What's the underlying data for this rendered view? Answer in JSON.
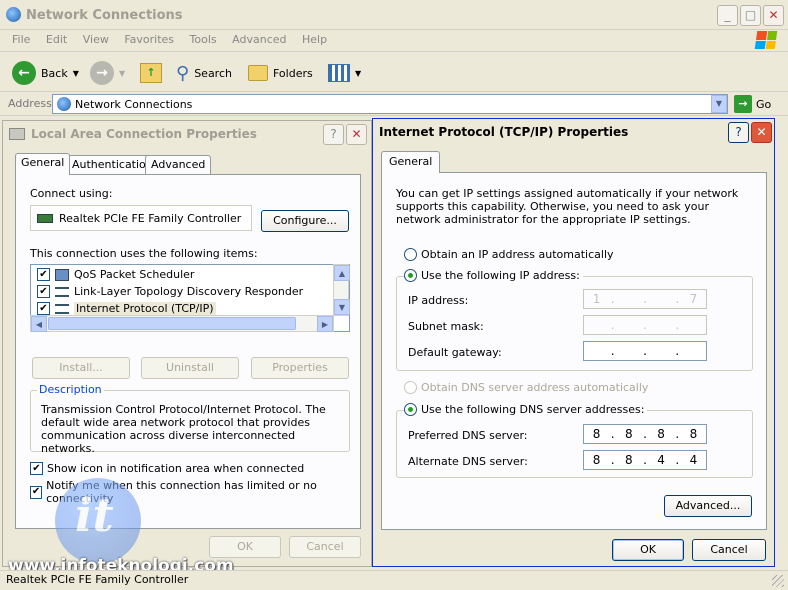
{
  "explorer": {
    "title": "Network Connections",
    "menu": [
      "File",
      "Edit",
      "View",
      "Favorites",
      "Tools",
      "Advanced",
      "Help"
    ],
    "toolbar": {
      "back": "Back",
      "search": "Search",
      "folders": "Folders"
    },
    "address_label": "Address",
    "address_value": "Network Connections",
    "go_label": "Go",
    "status_text": "Realtek PCIe FE Family Controller"
  },
  "lac_dialog": {
    "title": "Local Area Connection Properties",
    "tabs": [
      "General",
      "Authentication",
      "Advanced"
    ],
    "connect_using_label": "Connect using:",
    "adapter_name": "Realtek PCIe FE Family Controller",
    "configure_label": "Configure...",
    "items_label": "This connection uses the following items:",
    "items": [
      {
        "label": "QoS Packet Scheduler",
        "checked": true
      },
      {
        "label": "Link-Layer Topology Discovery Responder",
        "checked": true
      },
      {
        "label": "Internet Protocol (TCP/IP)",
        "checked": true
      }
    ],
    "install_label": "Install...",
    "uninstall_label": "Uninstall",
    "properties_label": "Properties",
    "description_title": "Description",
    "description_text": "Transmission Control Protocol/Internet Protocol. The default wide area network protocol that provides communication across diverse interconnected networks.",
    "show_icon_label": "Show icon in notification area when connected",
    "notify_label": "Notify me when this connection has limited or no connectivity",
    "ok_label": "OK",
    "cancel_label": "Cancel"
  },
  "tcpip_dialog": {
    "title": "Internet Protocol (TCP/IP) Properties",
    "tab": "General",
    "intro": "You can get IP settings assigned automatically if your network supports this capability. Otherwise, you need to ask your network administrator for the appropriate IP settings.",
    "obtain_ip_label": "Obtain an IP address automatically",
    "use_ip_label": "Use the following IP address:",
    "ip_label": "IP address:",
    "ip_value": [
      "1",
      "",
      "",
      "7"
    ],
    "subnet_label": "Subnet mask:",
    "subnet_value": [
      "",
      "",
      "",
      ""
    ],
    "gateway_label": "Default gateway:",
    "gateway_value": [
      "",
      "",
      "",
      ""
    ],
    "obtain_dns_label": "Obtain DNS server address automatically",
    "use_dns_label": "Use the following DNS server addresses:",
    "preferred_dns_label": "Preferred DNS server:",
    "preferred_dns_value": [
      "8",
      "8",
      "8",
      "8"
    ],
    "alternate_dns_label": "Alternate DNS server:",
    "alternate_dns_value": [
      "8",
      "8",
      "4",
      "4"
    ],
    "advanced_label": "Advanced...",
    "ok_label": "OK",
    "cancel_label": "Cancel"
  },
  "watermark": "www.infoteknologi.com",
  "colors": {
    "accent": "#21a121",
    "title_active": "#000000",
    "border_blue": "#003c74"
  }
}
